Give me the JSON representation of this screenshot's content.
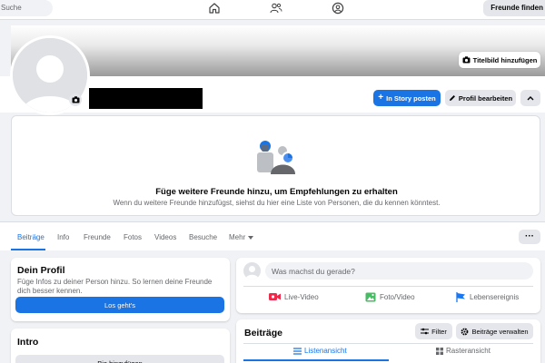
{
  "topnav": {
    "search_placeholder": "Suche",
    "icons": [
      "home-icon",
      "friends-icon",
      "groups-icon"
    ],
    "friends_button": "Freunde finden"
  },
  "cover": {
    "add_cover_label": "Titelbild hinzufügen"
  },
  "profile": {
    "add_story_label": "In Story posten",
    "edit_profile_label": "Profil bearbeiten"
  },
  "suggestions": {
    "title": "Füge weitere Freunde hinzu, um Empfehlungen zu erhalten",
    "text": "Wenn du weitere Freunde hinzufügst, siehst du hier eine Liste von Personen, die du kennen könntest."
  },
  "tabs": {
    "items": [
      "Beiträge",
      "Info",
      "Freunde",
      "Fotos",
      "Videos",
      "Besuche",
      "Mehr"
    ],
    "active": "Beiträge",
    "more_dots": "···"
  },
  "dein_profil": {
    "title": "Dein Profil",
    "text": "Füge Infos zu deiner Person hinzu. So lernen deine Freunde dich besser kennen.",
    "button": "Los geht's"
  },
  "intro": {
    "title": "Intro",
    "button": "Bio hinzufügen"
  },
  "composer": {
    "placeholder": "Was machst du gerade?",
    "actions": [
      {
        "label": "Live-Video",
        "color": "#f02849"
      },
      {
        "label": "Foto/Video",
        "color": "#45bd62"
      },
      {
        "label": "Lebensereignis",
        "color": "#1877f2"
      }
    ]
  },
  "posts": {
    "title": "Beiträge",
    "filter_label": "Filter",
    "manage_label": "Beiträge verwalten",
    "view_tabs": [
      "Listenansicht",
      "Rasteransicht"
    ],
    "active_view": "Listenansicht"
  },
  "colors": {
    "accent": "#1b74e4",
    "background": "#f0f2f5",
    "button_grey": "#e4e6eb",
    "secondary_text": "#65676b"
  }
}
